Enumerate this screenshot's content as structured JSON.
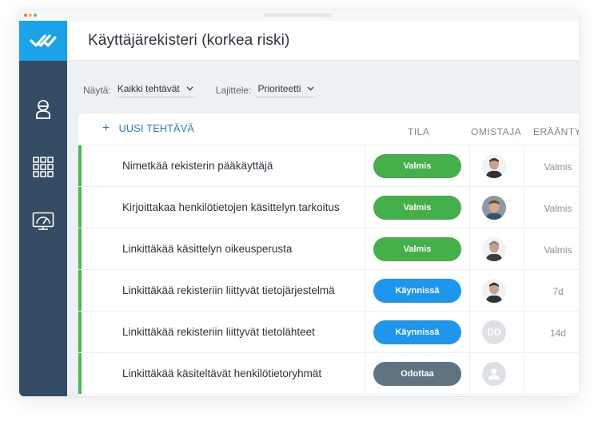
{
  "app": {
    "page_title": "Käyttäjärekisteri (korkea riski)",
    "accent_color": "#1aa3e8",
    "sidebar_color": "#344c63"
  },
  "sidebar": {
    "items": [
      {
        "icon": "user-icon"
      },
      {
        "icon": "grid-apps-icon"
      },
      {
        "icon": "monitor-dashboard-icon"
      }
    ]
  },
  "filters": {
    "show_label": "Näytä:",
    "show_value": "Kaikki tehtävät",
    "sort_label": "Lajittele:",
    "sort_value": "Prioriteetti"
  },
  "table": {
    "new_task_label": "UUSI TEHTÄVÄ",
    "columns": {
      "status": "TILA",
      "owner": "OMISTAJA",
      "due": "ERÄÄNTY"
    },
    "rows": [
      {
        "task": "Nimetkää rekisterin pääkäyttäjä",
        "status": "Valmis",
        "status_color": "#43b049",
        "owner_initials": "",
        "due": "Valmis"
      },
      {
        "task": "Kirjoittakaa henkilötietojen käsittelyn tarkoitus",
        "status": "Valmis",
        "status_color": "#43b049",
        "owner_initials": "",
        "due": "Valmis"
      },
      {
        "task": "Linkittäkää käsittelyn oikeusperusta",
        "status": "Valmis",
        "status_color": "#43b049",
        "owner_initials": "",
        "due": "Valmis"
      },
      {
        "task": "Linkittäkää rekisteriin liittyvät tietojärjestelmä",
        "status": "Käynnissä",
        "status_color": "#1e96ee",
        "owner_initials": "",
        "due": "7d"
      },
      {
        "task": "Linkittäkää rekisteriin liittyvät tietolähteet",
        "status": "Käynnissä",
        "status_color": "#1e96ee",
        "owner_initials": "DD",
        "due": "14d"
      },
      {
        "task": "Linkittäkää käsiteltävät henkilötietoryhmät",
        "status": "Odottaa",
        "status_color": "#5f7480",
        "owner_initials": "",
        "due": ""
      }
    ]
  }
}
